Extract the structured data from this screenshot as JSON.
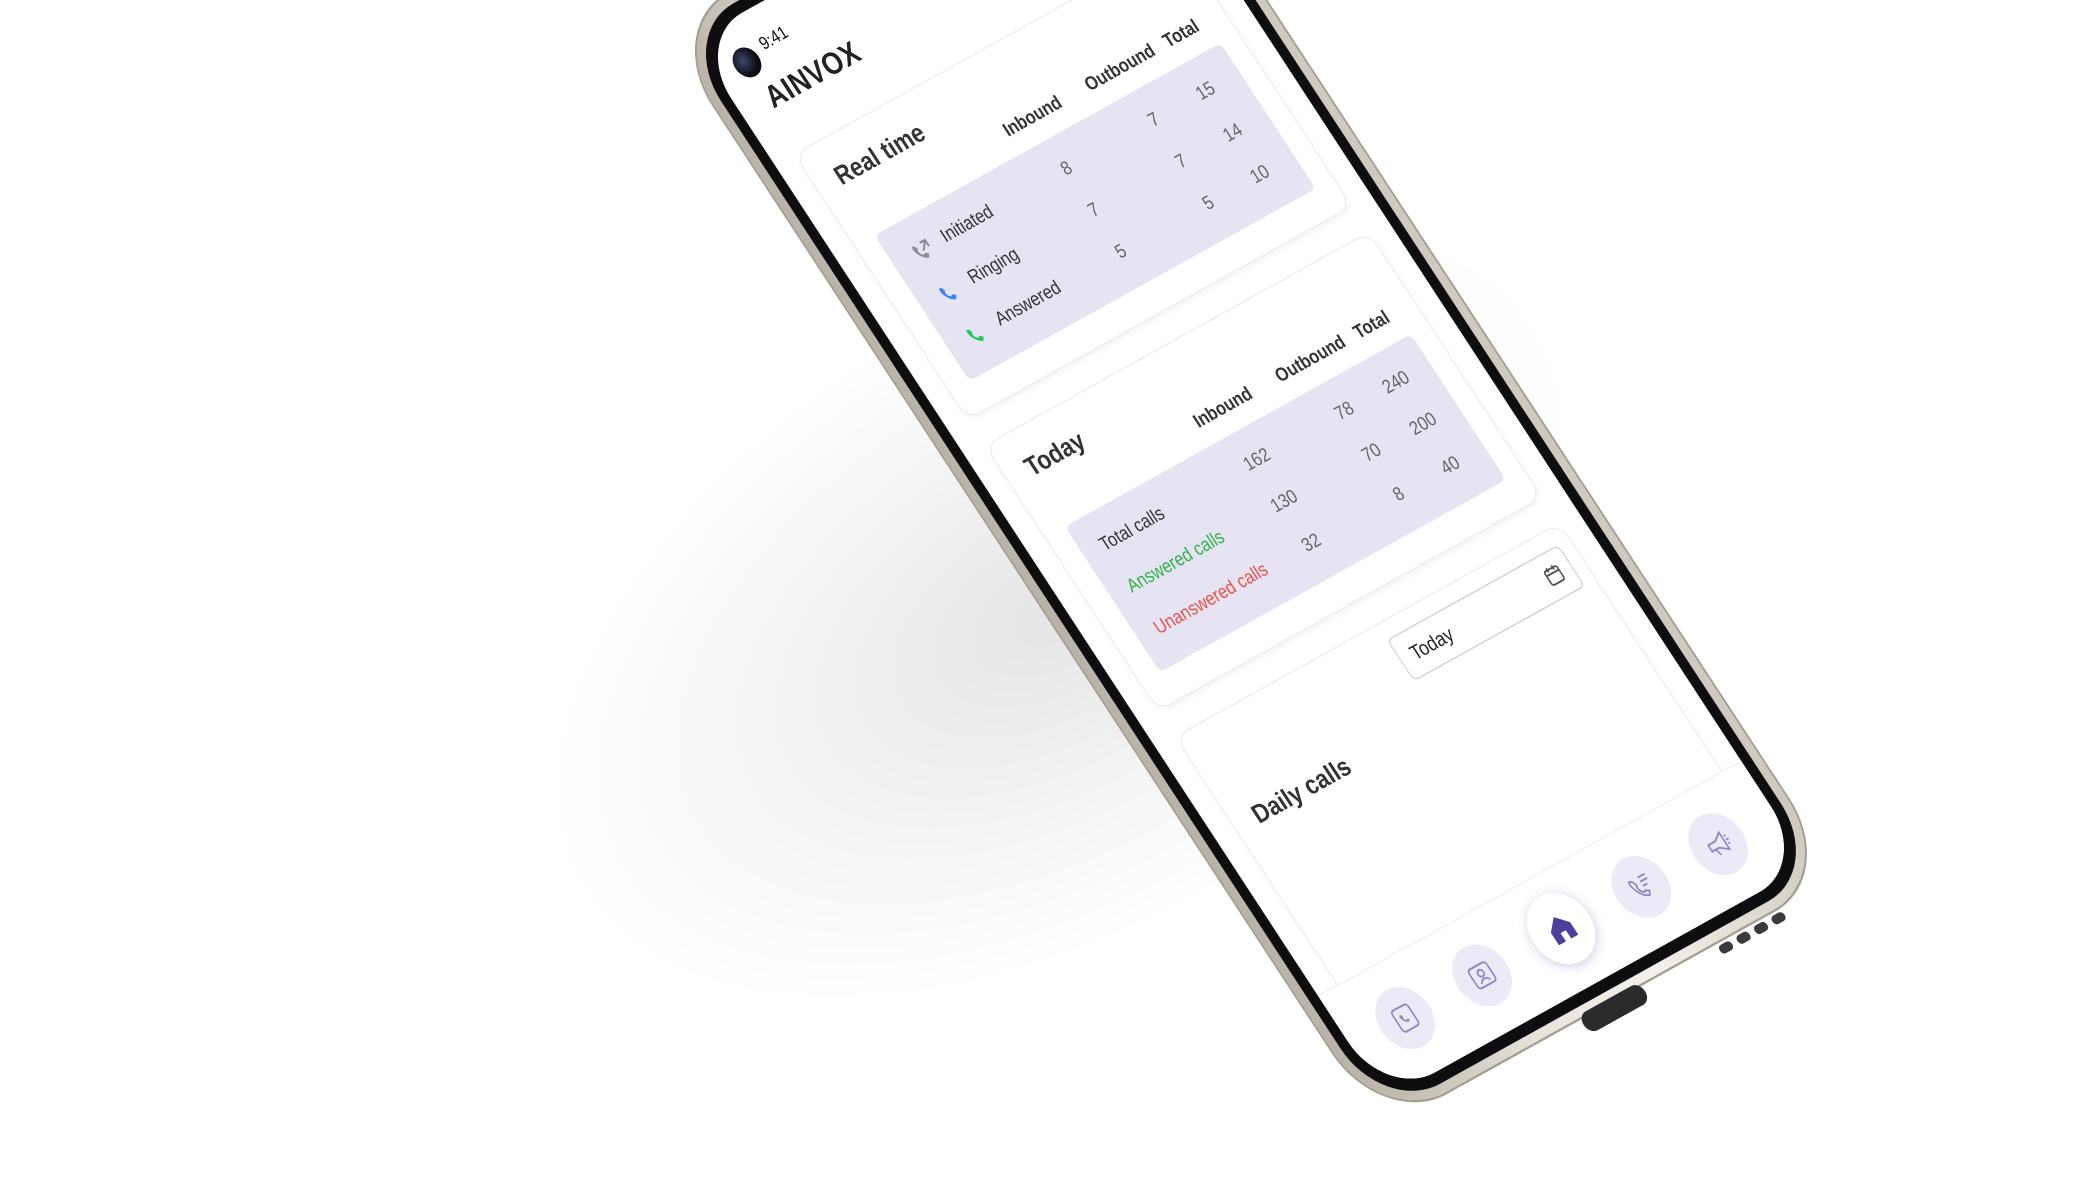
{
  "status": {
    "time": "9:41"
  },
  "app": {
    "title": "AINVOX"
  },
  "realtime": {
    "title": "Real time",
    "headers": [
      "Inbound",
      "Outbound",
      "Total"
    ],
    "rows": [
      {
        "label": "Initiated",
        "icon": "outgoing-call-icon",
        "values": [
          "8",
          "7",
          "15"
        ]
      },
      {
        "label": "Ringing",
        "icon": "ringing-phone-icon",
        "values": [
          "7",
          "7",
          "14"
        ]
      },
      {
        "label": "Answered",
        "icon": "answered-phone-icon",
        "values": [
          "5",
          "5",
          "10"
        ]
      }
    ]
  },
  "today": {
    "title": "Today",
    "headers": [
      "Inbound",
      "Outbound",
      "Total"
    ],
    "rows": [
      {
        "label": "Total calls",
        "values": [
          "162",
          "78",
          "240"
        ]
      },
      {
        "label": "Answered calls",
        "values": [
          "130",
          "70",
          "200"
        ]
      },
      {
        "label": "Unanswered calls",
        "values": [
          "32",
          "8",
          "40"
        ]
      }
    ]
  },
  "daily": {
    "title": "Daily calls",
    "date_value": "Today"
  },
  "nav": {
    "items": [
      "call-log-icon",
      "contacts-icon",
      "home-icon",
      "call-list-icon",
      "campaign-icon"
    ],
    "active": "home-icon"
  },
  "colors": {
    "table_bg": "#e6e4f3",
    "accent": "#4a3f9f",
    "answered_green": "#2fb344",
    "unanswered_red": "#e5534b"
  }
}
